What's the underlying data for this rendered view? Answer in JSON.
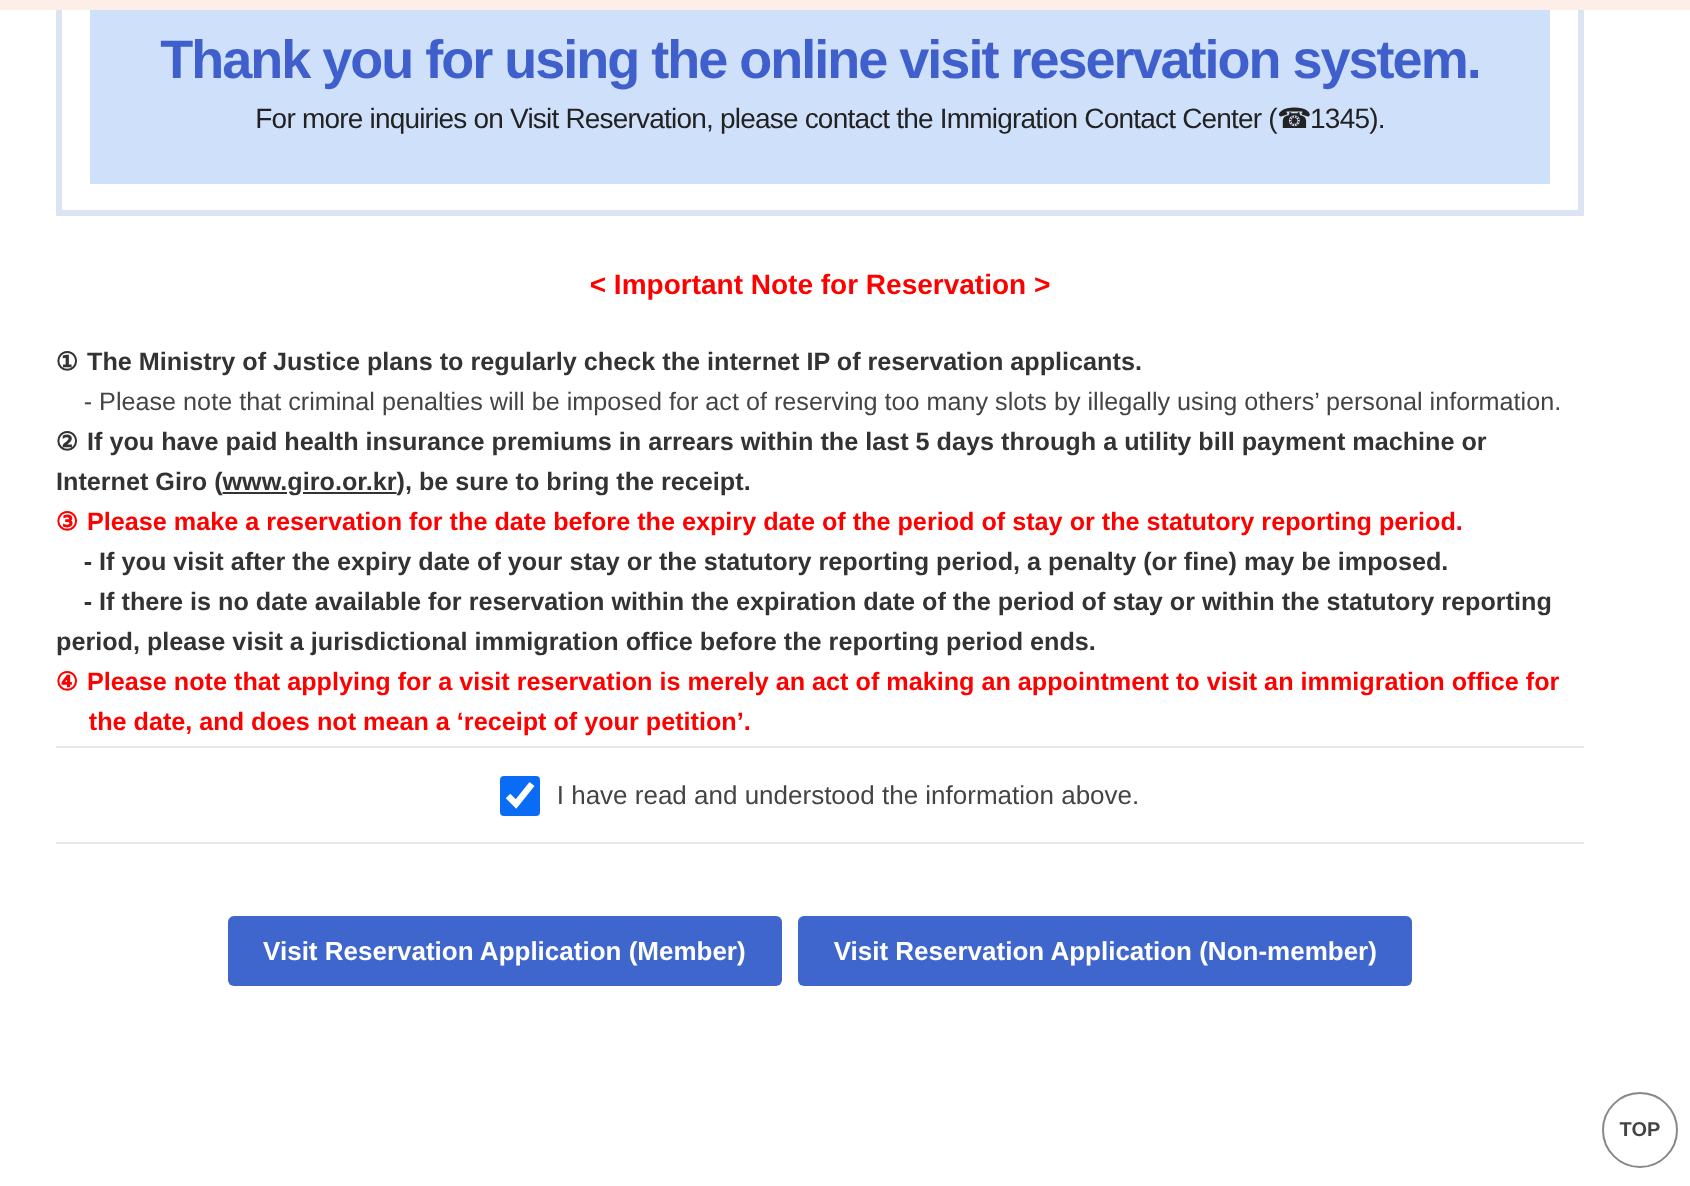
{
  "banner": {
    "title": "Thank you for using the online visit reservation system.",
    "subtitle": "For more inquiries on Visit Reservation, please contact the Immigration Contact Center (☎1345)."
  },
  "notice": {
    "heading": "< Important Note for Reservation >",
    "lines": [
      {
        "kind": "main",
        "text": "① The Ministry of Justice plans to regularly check the internet IP of reservation applicants."
      },
      {
        "kind": "detail",
        "text": "- Please note that criminal penalties will be imposed for act of reserving too many slots by illegally using others’ personal information."
      },
      {
        "kind": "main",
        "text": "② If you have paid health insurance premiums in arrears within the last 5 days through a utility bill payment machine or Internet Giro (",
        "link": "www.giro.or.kr",
        "text_after": "), be sure to bring the receipt."
      },
      {
        "kind": "warning",
        "text": "③ Please make a reservation for the date before the expiry date of the period of stay or the statutory reporting period."
      },
      {
        "kind": "detail-bold",
        "text": "- If you visit after the expiry date of your stay or the statutory reporting period, a penalty (or fine) may be imposed."
      },
      {
        "kind": "detail-bold",
        "text": "- If there is no date available for reservation within the expiration date of the period of stay or within the statutory reporting period, please visit a jurisdictional immigration office before the reporting period ends."
      },
      {
        "kind": "warning-hanging",
        "text": "④ Please note that applying for a visit reservation is merely an act of making an appointment to visit an immigration office for the date, and does not mean a ‘receipt of your petition’."
      }
    ]
  },
  "agreement": {
    "label": "I have read and understood the information above.",
    "checked": true
  },
  "buttons": [
    "Visit Reservation Application (Member)",
    "Visit Reservation Application (Non-member)"
  ],
  "top_button": "TOP"
}
